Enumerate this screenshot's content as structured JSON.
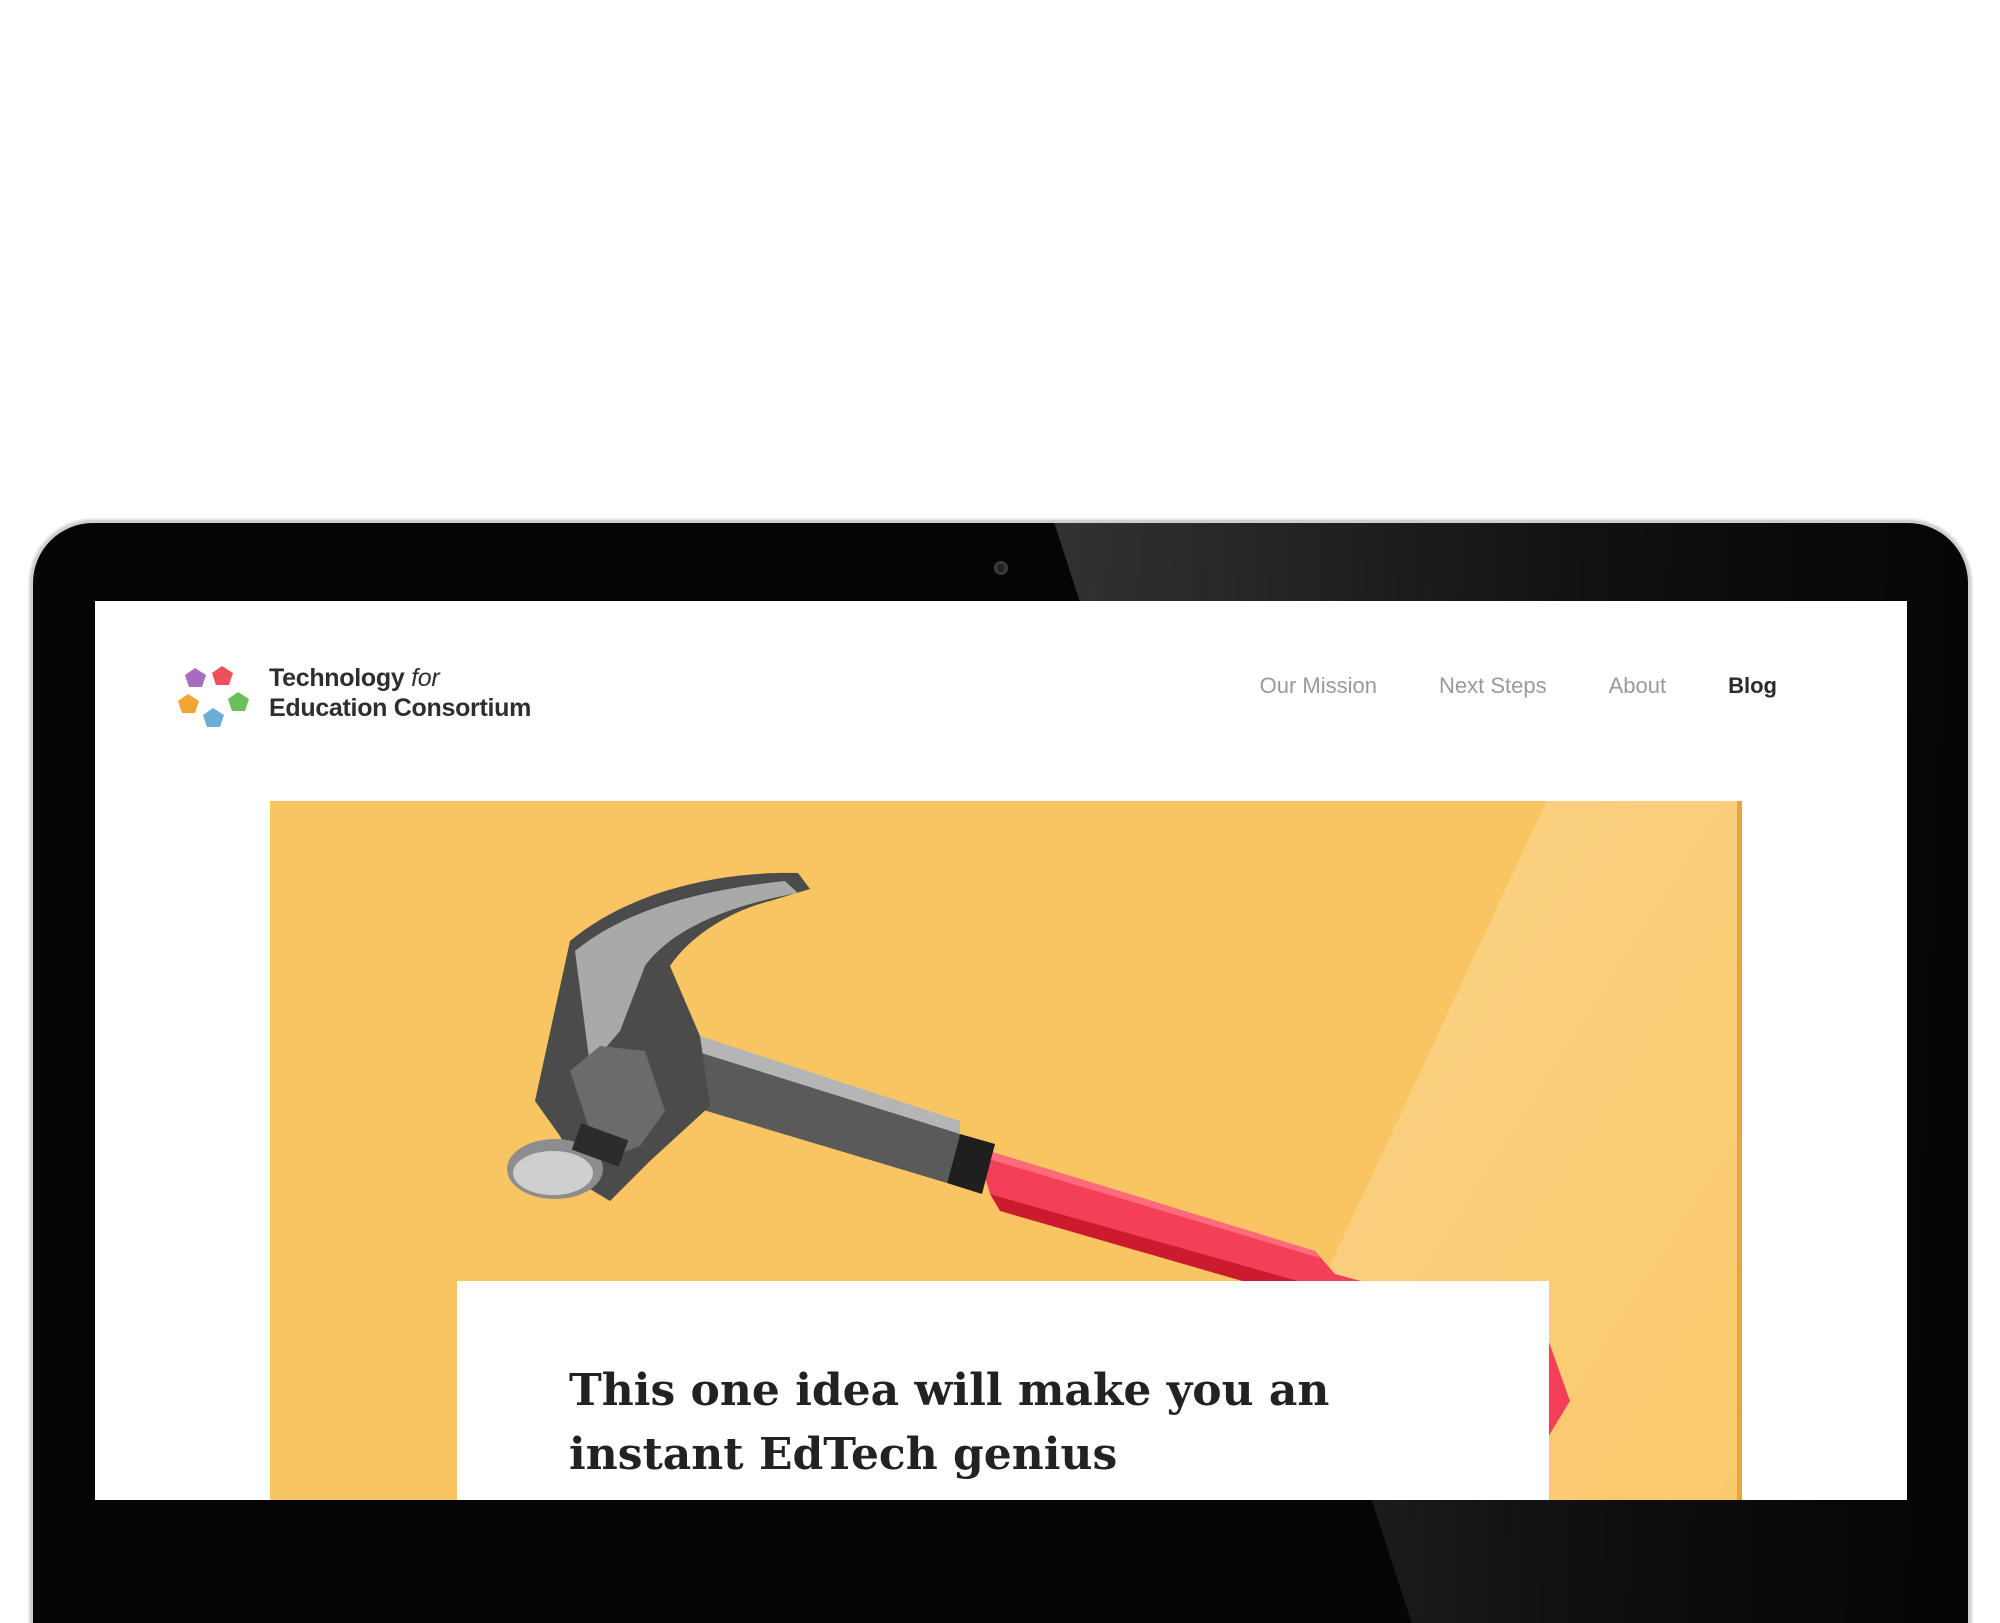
{
  "brand": {
    "line1_main": "Technology",
    "line1_italic": "for",
    "line2": "Education Consortium",
    "logo_colors": [
      "#a76bc2",
      "#f0505a",
      "#f3a531",
      "#6cbe58",
      "#6aaed6"
    ]
  },
  "nav": {
    "items": [
      {
        "label": "Our Mission",
        "active": false
      },
      {
        "label": "Next Steps",
        "active": false
      },
      {
        "label": "About",
        "active": false
      },
      {
        "label": "Blog",
        "active": true
      }
    ]
  },
  "hero": {
    "background_color": "#f9c562",
    "image_icon": "hammer-icon",
    "headline_line1": "This one idea will make you an",
    "headline_line2": "instant EdTech genius"
  }
}
